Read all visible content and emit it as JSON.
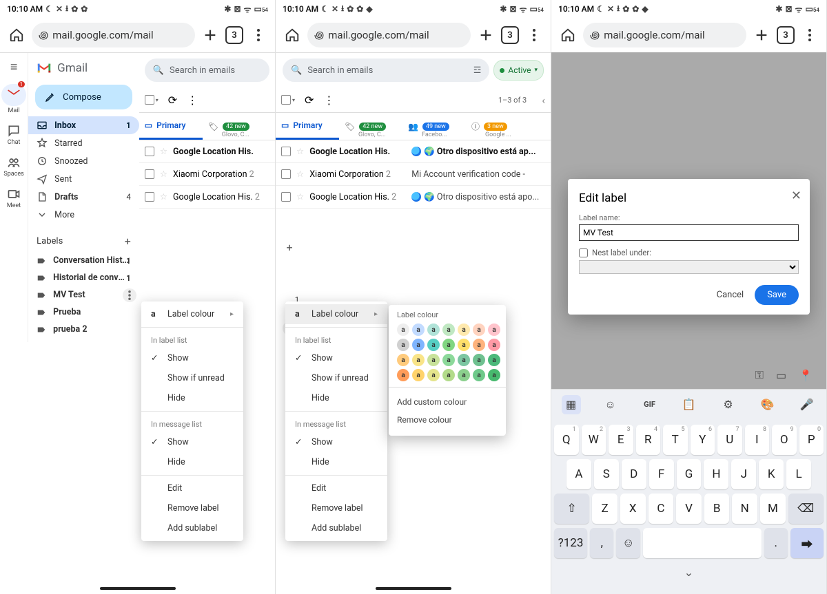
{
  "status": {
    "time": "10:10 AM",
    "icons_left": "☾ ✕ ⭳ ✿ ✿",
    "icons_right": "⚭ ⊠ ⦿ 📶",
    "battery": "54"
  },
  "browser": {
    "url": "mail.google.com/mail",
    "tabs": "3"
  },
  "gmail": {
    "brand": "Gmail",
    "compose": "Compose",
    "rail": {
      "mail": "Mail",
      "chat": "Chat",
      "spaces": "Spaces",
      "meet": "Meet",
      "mail_badge": "1"
    },
    "nav": {
      "inbox": {
        "label": "Inbox",
        "count": "1"
      },
      "starred": "Starred",
      "snoozed": "Snoozed",
      "sent": "Sent",
      "drafts": {
        "label": "Drafts",
        "count": "4"
      },
      "more": "More"
    },
    "labels_header": "Labels",
    "labels": [
      {
        "name": "Conversation History",
        "count": "1"
      },
      {
        "name": "Historial de convers...",
        "count": "1"
      },
      {
        "name": "MV Test",
        "count": ""
      },
      {
        "name": "Prueba",
        "count": ""
      },
      {
        "name": "prueba 2",
        "count": ""
      }
    ],
    "search_placeholder": "Search in emails",
    "active_chip": "Active",
    "pager": "1–3 of 3",
    "tabs": {
      "primary": "Primary",
      "promo_badge": "42 new",
      "promo_sub": "Glovo, C...",
      "social_badge": "49 new",
      "social_sub": "Facebo...",
      "updates_badge": "3 new",
      "updates_sub": "Google ..."
    },
    "messages": [
      {
        "from": "Google Location His.",
        "n": "",
        "subj": "🌍 Otro dispositivo está ap...",
        "unread": true,
        "globe": true
      },
      {
        "from": "Xiaomi Corporation",
        "n": "2",
        "subj": "Mi Account verification code -",
        "unread": false,
        "globe": false
      },
      {
        "from": "Google Location His.",
        "n": "2",
        "subj": "🌍 Otro dispositivo está apo...",
        "unread": false,
        "globe": true
      }
    ]
  },
  "ctx": {
    "label_colour": "Label colour",
    "in_label_list": "In label list",
    "show": "Show",
    "show_if_unread": "Show if unread",
    "hide": "Hide",
    "in_message_list": "In message list",
    "edit": "Edit",
    "remove_label": "Remove label",
    "add_sublabel": "Add sublabel"
  },
  "colorpop": {
    "title": "Label colour",
    "add": "Add custom colour",
    "remove": "Remove colour",
    "swatches": [
      "#eeeeee",
      "#c2dbff",
      "#b0e3d8",
      "#c0e8c2",
      "#ffe9ad",
      "#ffd3bf",
      "#ffc4cc",
      "#d0d0d0",
      "#7fb5ff",
      "#57cfc4",
      "#81d681",
      "#ffe06b",
      "#ffb37d",
      "#ff9aa6",
      "#ffcb7d",
      "#f9e488",
      "#c8e29a",
      "#8cd99a",
      "#7cc6a2",
      "#6fc190",
      "#4cb97b",
      "#ff9c59",
      "#ffd36b",
      "#e4e48c",
      "#b2db8a",
      "#8bd08d",
      "#6ec98a",
      "#47b96e"
    ]
  },
  "dialog": {
    "title": "Edit label",
    "name_label": "Label name:",
    "name_value": "MV Test",
    "nest_label": "Nest label under:",
    "cancel": "Cancel",
    "save": "Save"
  },
  "keyboard": {
    "row1": [
      [
        "Q",
        "1"
      ],
      [
        "W",
        "2"
      ],
      [
        "E",
        "3"
      ],
      [
        "R",
        "4"
      ],
      [
        "T",
        "5"
      ],
      [
        "Y",
        "6"
      ],
      [
        "U",
        "7"
      ],
      [
        "I",
        "8"
      ],
      [
        "O",
        "9"
      ],
      [
        "P",
        "0"
      ]
    ],
    "row2": [
      "A",
      "S",
      "D",
      "F",
      "G",
      "H",
      "J",
      "K",
      "L"
    ],
    "row3": [
      "Z",
      "X",
      "C",
      "V",
      "B",
      "N",
      "M"
    ],
    "numkey": "?123",
    "comma": ",",
    "period": "."
  }
}
